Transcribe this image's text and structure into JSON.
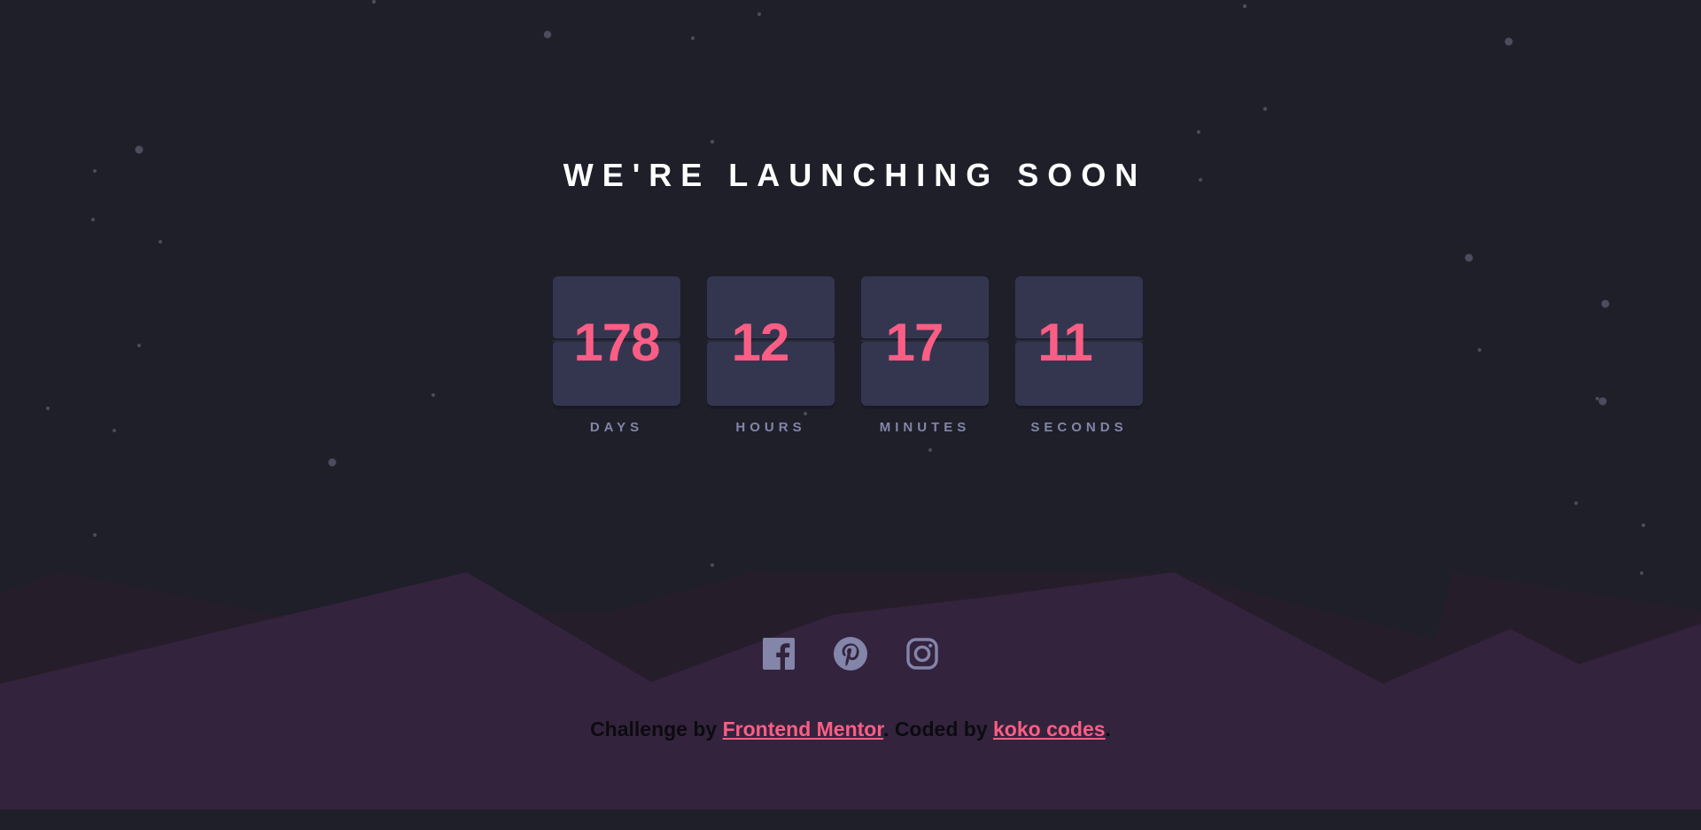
{
  "title": "WE'RE LAUNCHING SOON",
  "countdown": [
    {
      "value": "178",
      "label": "DAYS"
    },
    {
      "value": "12",
      "label": "HOURS"
    },
    {
      "value": "17",
      "label": "MINUTES"
    },
    {
      "value": "11",
      "label": "SECONDS"
    }
  ],
  "socials": [
    {
      "icon": "facebook-icon"
    },
    {
      "icon": "pinterest-icon"
    },
    {
      "icon": "instagram-icon"
    }
  ],
  "footer": {
    "prefix": "Challenge by ",
    "link1": "Frontend Mentor",
    "middle": ". Coded by ",
    "link2": "koko codes",
    "suffix": "."
  },
  "colors": {
    "background": "#1e1f29",
    "card": "#343650",
    "accent": "#fb5e84",
    "label": "#8385a9",
    "hills": "#34233d",
    "hills_dark": "#261d2b"
  }
}
